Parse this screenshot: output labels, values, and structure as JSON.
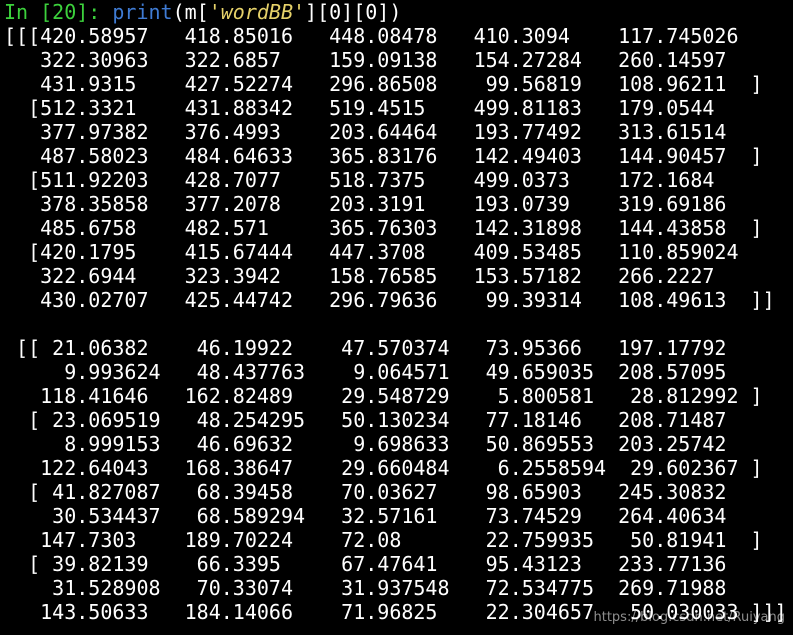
{
  "prompt": {
    "label": "In [20]: ",
    "func": "print",
    "open": "(m[",
    "key": "'wordBB'",
    "close": "][0][0])"
  },
  "block1": [
    "[[[420.58957   418.85016   448.08478   410.3094    117.745026",
    "   322.30963   322.6857    159.09138   154.27284   260.14597",
    "   431.9315    427.52274   296.86508    99.56819   108.96211  ]",
    "  [512.3321    431.88342   519.4515    499.81183   179.0544",
    "   377.97382   376.4993    203.64464   193.77492   313.61514",
    "   487.58023   484.64633   365.83176   142.49403   144.90457  ]",
    "  [511.92203   428.7077    518.7375    499.0373    172.1684",
    "   378.35858   377.2078    203.3191    193.0739    319.69186",
    "   485.6758    482.571     365.76303   142.31898   144.43858  ]",
    "  [420.1795    415.67444   447.3708    409.53485   110.859024",
    "   322.6944    323.3942    158.76585   153.57182   266.2227",
    "   430.02707   425.44742   296.79636    99.39314   108.49613  ]]"
  ],
  "block2": [
    " [[ 21.06382    46.19922    47.570374   73.95366   197.17792",
    "     9.993624   48.437763    9.064571   49.659035  208.57095",
    "   118.41646   162.82489    29.548729    5.800581   28.812992 ]",
    "  [ 23.069519   48.254295   50.130234   77.18146   208.71487",
    "     8.999153   46.69632     9.698633   50.869553  203.25742",
    "   122.64043   168.38647    29.660484    6.2558594  29.602367 ]",
    "  [ 41.827087   68.39458    70.03627    98.65903   245.30832",
    "    30.534437   68.589294   32.57161    73.74529   264.40634",
    "   147.7303    189.70224    72.08       22.759935   50.81941  ]",
    "  [ 39.82139    66.3395     67.47641    95.43123   233.77136",
    "    31.528908   70.33074    31.937548   72.534775  269.71988",
    "   143.50633   184.14066    71.96825    22.304657   50.030033 ]]]"
  ],
  "watermark": "https://blog.csdn.net/Ruiyang"
}
